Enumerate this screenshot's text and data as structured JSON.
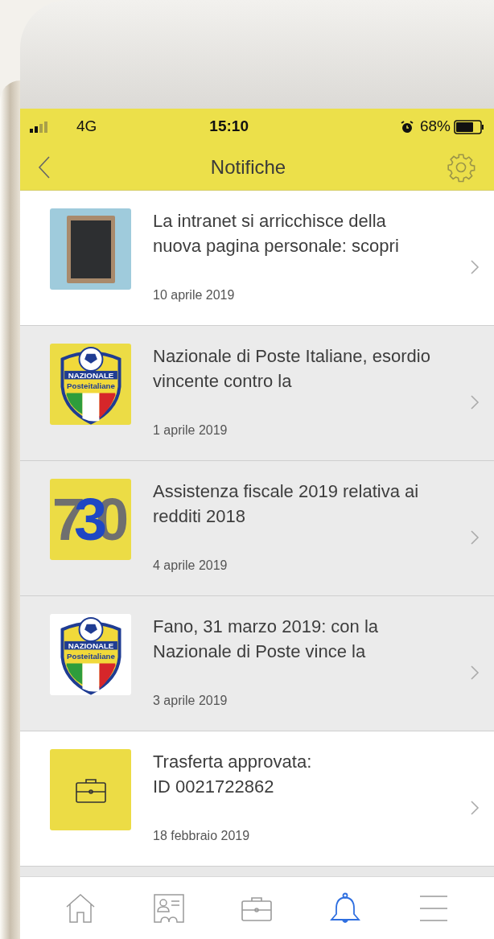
{
  "status_bar": {
    "network": "4G",
    "time": "15:10",
    "battery": "68%"
  },
  "header": {
    "title": "Notifiche"
  },
  "notifications": [
    {
      "kind": "photo",
      "title": "La intranet si arricchisce della nuova pagina personale: scopri",
      "date": "10 aprile 2019",
      "read": false
    },
    {
      "kind": "badge",
      "badge_top": "NAZIONALE",
      "badge_label": "Posteitaliane",
      "color": "#ecdc45",
      "title": "Nazionale di Poste Italiane, esordio vincente contro la",
      "date": "1 aprile 2019",
      "read": true
    },
    {
      "kind": "logo",
      "logo_text": "730",
      "title": "Assistenza fiscale 2019 relativa ai redditi 2018",
      "date": "4 aprile 2019",
      "read": true
    },
    {
      "kind": "badge",
      "badge_top": "NAZIONALE",
      "badge_label": "Posteitaliane",
      "color": "#ffffff",
      "title": "Fano, 31 marzo 2019: con la Nazionale di Poste vince la",
      "date": "3 aprile 2019",
      "read": true
    },
    {
      "kind": "briefcase",
      "title": "Trasferta approvata:",
      "subtitle": "ID 0021722862",
      "date": "18 febbraio 2019",
      "read": false
    }
  ],
  "tab_bar": [
    {
      "kind": "home",
      "selected": false
    },
    {
      "kind": "contact",
      "selected": false
    },
    {
      "kind": "briefcase",
      "selected": false
    },
    {
      "kind": "bell",
      "selected": true
    },
    {
      "kind": "menu",
      "selected": false
    }
  ]
}
